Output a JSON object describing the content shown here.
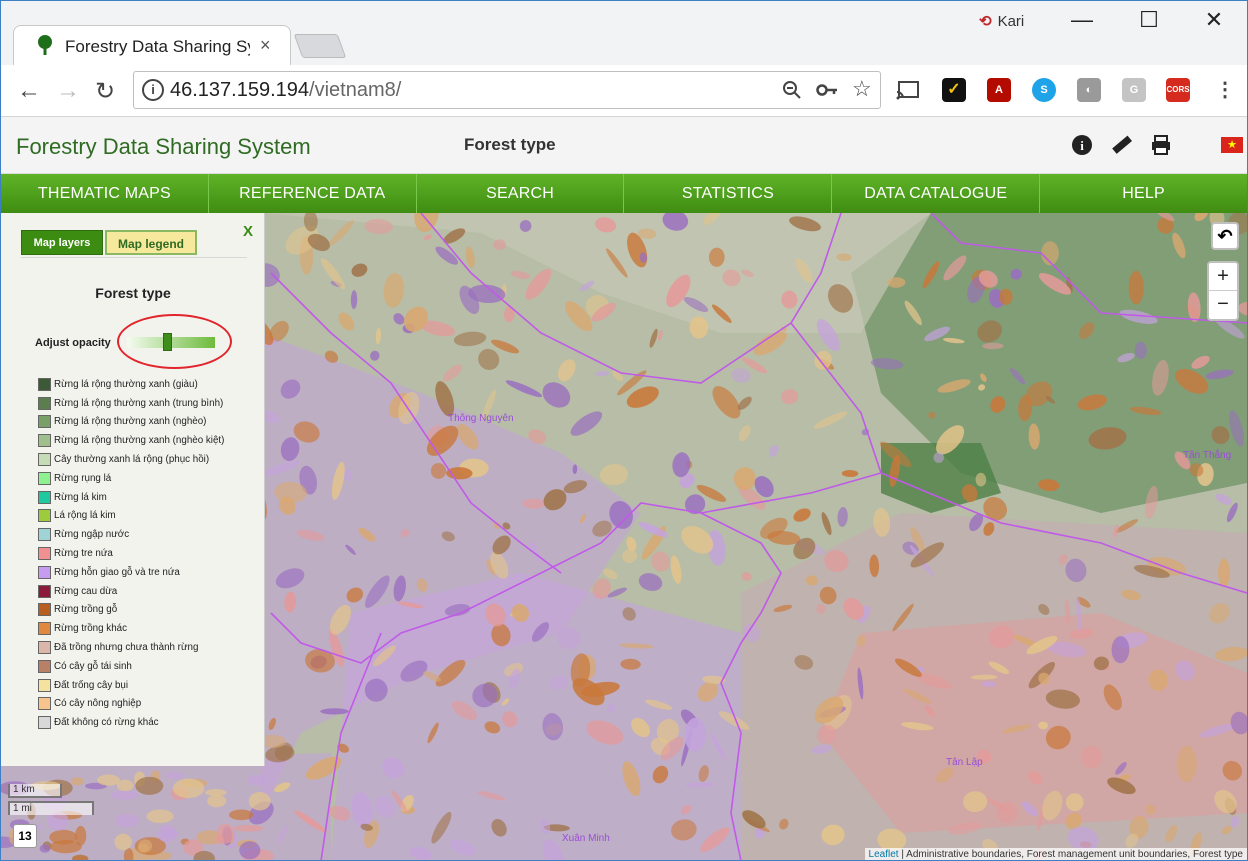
{
  "browser": {
    "tab_title": "Forestry Data Sharing Sys",
    "tab_close": "×",
    "profile_name": "Kari",
    "url_host": "46.137.159.194",
    "url_path": "/vietnam8/",
    "window_minimize": "—",
    "window_maximize": "☐",
    "window_close": "✕",
    "back": "←",
    "forward": "→",
    "reload": "↻",
    "ext_cors": "CORS",
    "ext_g": "G"
  },
  "app": {
    "title": "Forestry Data Sharing System",
    "page_title": "Forest type",
    "nav": [
      "THEMATIC MAPS",
      "REFERENCE DATA",
      "SEARCH",
      "STATISTICS",
      "DATA CATALOGUE",
      "HELP"
    ]
  },
  "panel": {
    "tab_layers": "Map layers",
    "tab_legend": "Map legend",
    "close": "X",
    "legend_title": "Forest type",
    "opacity_label": "Adjust opacity",
    "opacity_value": 0.45,
    "legend_items": [
      {
        "label": "Rừng lá rộng thường xanh (giàu)",
        "color": "#3d5a36"
      },
      {
        "label": "Rừng lá rộng thường xanh (trung bình)",
        "color": "#5a7e4e"
      },
      {
        "label": "Rừng lá rộng thường xanh (nghèo)",
        "color": "#7aa06a"
      },
      {
        "label": "Rừng lá rộng thường xanh (nghèo kiệt)",
        "color": "#9fbf8d"
      },
      {
        "label": "Cây thường xanh lá rộng (phục hồi)",
        "color": "#c5dcb7"
      },
      {
        "label": "Rừng rụng lá",
        "color": "#8ef08e"
      },
      {
        "label": "Rừng lá kim",
        "color": "#1ec9a0"
      },
      {
        "label": "Lá rộng lá kim",
        "color": "#9ccc3c"
      },
      {
        "label": "Rừng ngập nước",
        "color": "#9fd3d6"
      },
      {
        "label": "Rừng tre nứa",
        "color": "#f09090"
      },
      {
        "label": "Rừng hỗn giao gỗ và tre nứa",
        "color": "#c69bf0"
      },
      {
        "label": "Rừng cau dừa",
        "color": "#8c1a3a"
      },
      {
        "label": "Rừng trồng gỗ",
        "color": "#b85e1e"
      },
      {
        "label": "Rừng trồng khác",
        "color": "#e08840"
      },
      {
        "label": "Đã trồng nhưng chưa thành rừng",
        "color": "#dcb6a8"
      },
      {
        "label": "Có cây gỗ tái sinh",
        "color": "#b88066"
      },
      {
        "label": "Đất trống cây bụi",
        "color": "#f5e2a0"
      },
      {
        "label": "Có cây nông nghiệp",
        "color": "#f7c48e"
      },
      {
        "label": "Đất không có rừng khác",
        "color": "#d8d8d8"
      }
    ]
  },
  "map": {
    "places": [
      "Thông Nguyên",
      "Tân Thắng",
      "Tân Lập",
      "Xuân Minh"
    ],
    "scale_km": "1 km",
    "scale_mi": "1 mi",
    "zoom_level": "13",
    "zoom_in": "+",
    "zoom_out": "−",
    "undo": "↶",
    "attribution_link": "Leaflet",
    "attribution_text": " | Administrative boundaries, Forest management unit boundaries, Forest type",
    "colors": {
      "boundary": "#c05ae8",
      "purple": "#c4a3dc",
      "orange": "#c9783a",
      "pink": "#e49a9a",
      "tan": "#e3c48c",
      "green": "#5f8a57"
    }
  }
}
